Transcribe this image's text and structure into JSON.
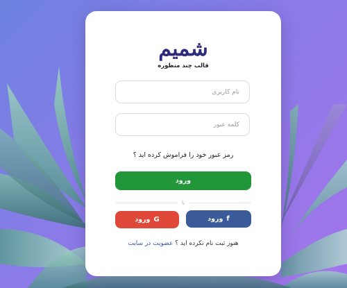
{
  "logo": {
    "mark": "شمیم",
    "tagline": "قالب چند منظوره"
  },
  "form": {
    "username_placeholder": "نام کاربری",
    "password_placeholder": "کلمه عبور",
    "username_value": "",
    "password_value": "",
    "forgot_password": "رمز عبور خود را فراموش کرده اید ؟",
    "login_button": "ورود"
  },
  "social": {
    "divider_text": "یا",
    "facebook_label": "ورود",
    "facebook_icon": "f",
    "google_label": "ورود",
    "google_icon": "G"
  },
  "register": {
    "prompt": "هنوز ثبت نام نکرده اید ؟",
    "link": "عضویت در سایت"
  },
  "colors": {
    "primary": "#22973a",
    "facebook": "#3b5a9a",
    "google": "#e0483a",
    "brand": "#2e2c7a",
    "link": "#3a4fb0"
  }
}
